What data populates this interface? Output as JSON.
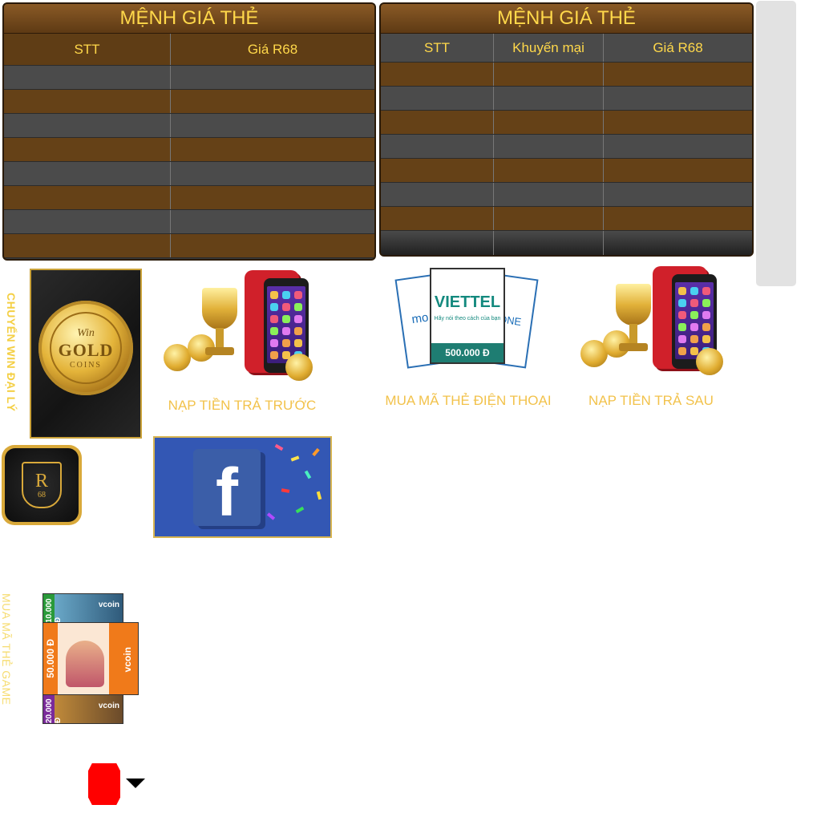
{
  "left_table": {
    "title": "MỆNH GIÁ THẺ",
    "columns": [
      "STT",
      "Giá R68"
    ],
    "row_count": 8
  },
  "right_table": {
    "title": "MỆNH GIÁ THẺ",
    "columns": [
      "STT",
      "Khuyến mại",
      "Giá R68"
    ],
    "row_count": 8
  },
  "tiles": {
    "agent_vertical_label": "CHUYỂN WIN ĐẠI LÝ",
    "gold_card": {
      "line1": "Win",
      "line2": "GOLD",
      "line3": "COINS"
    },
    "r68_icon": {
      "letter": "R",
      "number": "68"
    },
    "prepaid_caption": "NẠP TIỀN TRẢ TRƯỚC",
    "phone_card_caption": "MUA MÃ THẺ ĐIỆN THOẠI",
    "postpaid_caption": "NẠP TIỀN TRẢ SAU",
    "viettel": {
      "brand": "VIETTEL",
      "slogan": "Hãy nói theo cách của bạn",
      "amount": "500.000 Đ"
    },
    "mobifone_fragment": "mo",
    "vina_fragment": "ONE",
    "facebook_letter": "f",
    "game_vertical_label": "MUA MÃ THẺ GAME",
    "game_cards": [
      {
        "amount": "10.000 Đ",
        "brand": "vcoin"
      },
      {
        "amount": "50.000 Đ",
        "brand": "vcoin"
      },
      {
        "amount": "20.000 Đ",
        "brand": "vcoin"
      }
    ]
  },
  "colors": {
    "title_gold": "#ffd84a",
    "row_brown": "#654117",
    "row_gray": "#4b4b4b",
    "caption_gold": "#f2c24b",
    "flag_red": "#ff0000"
  }
}
